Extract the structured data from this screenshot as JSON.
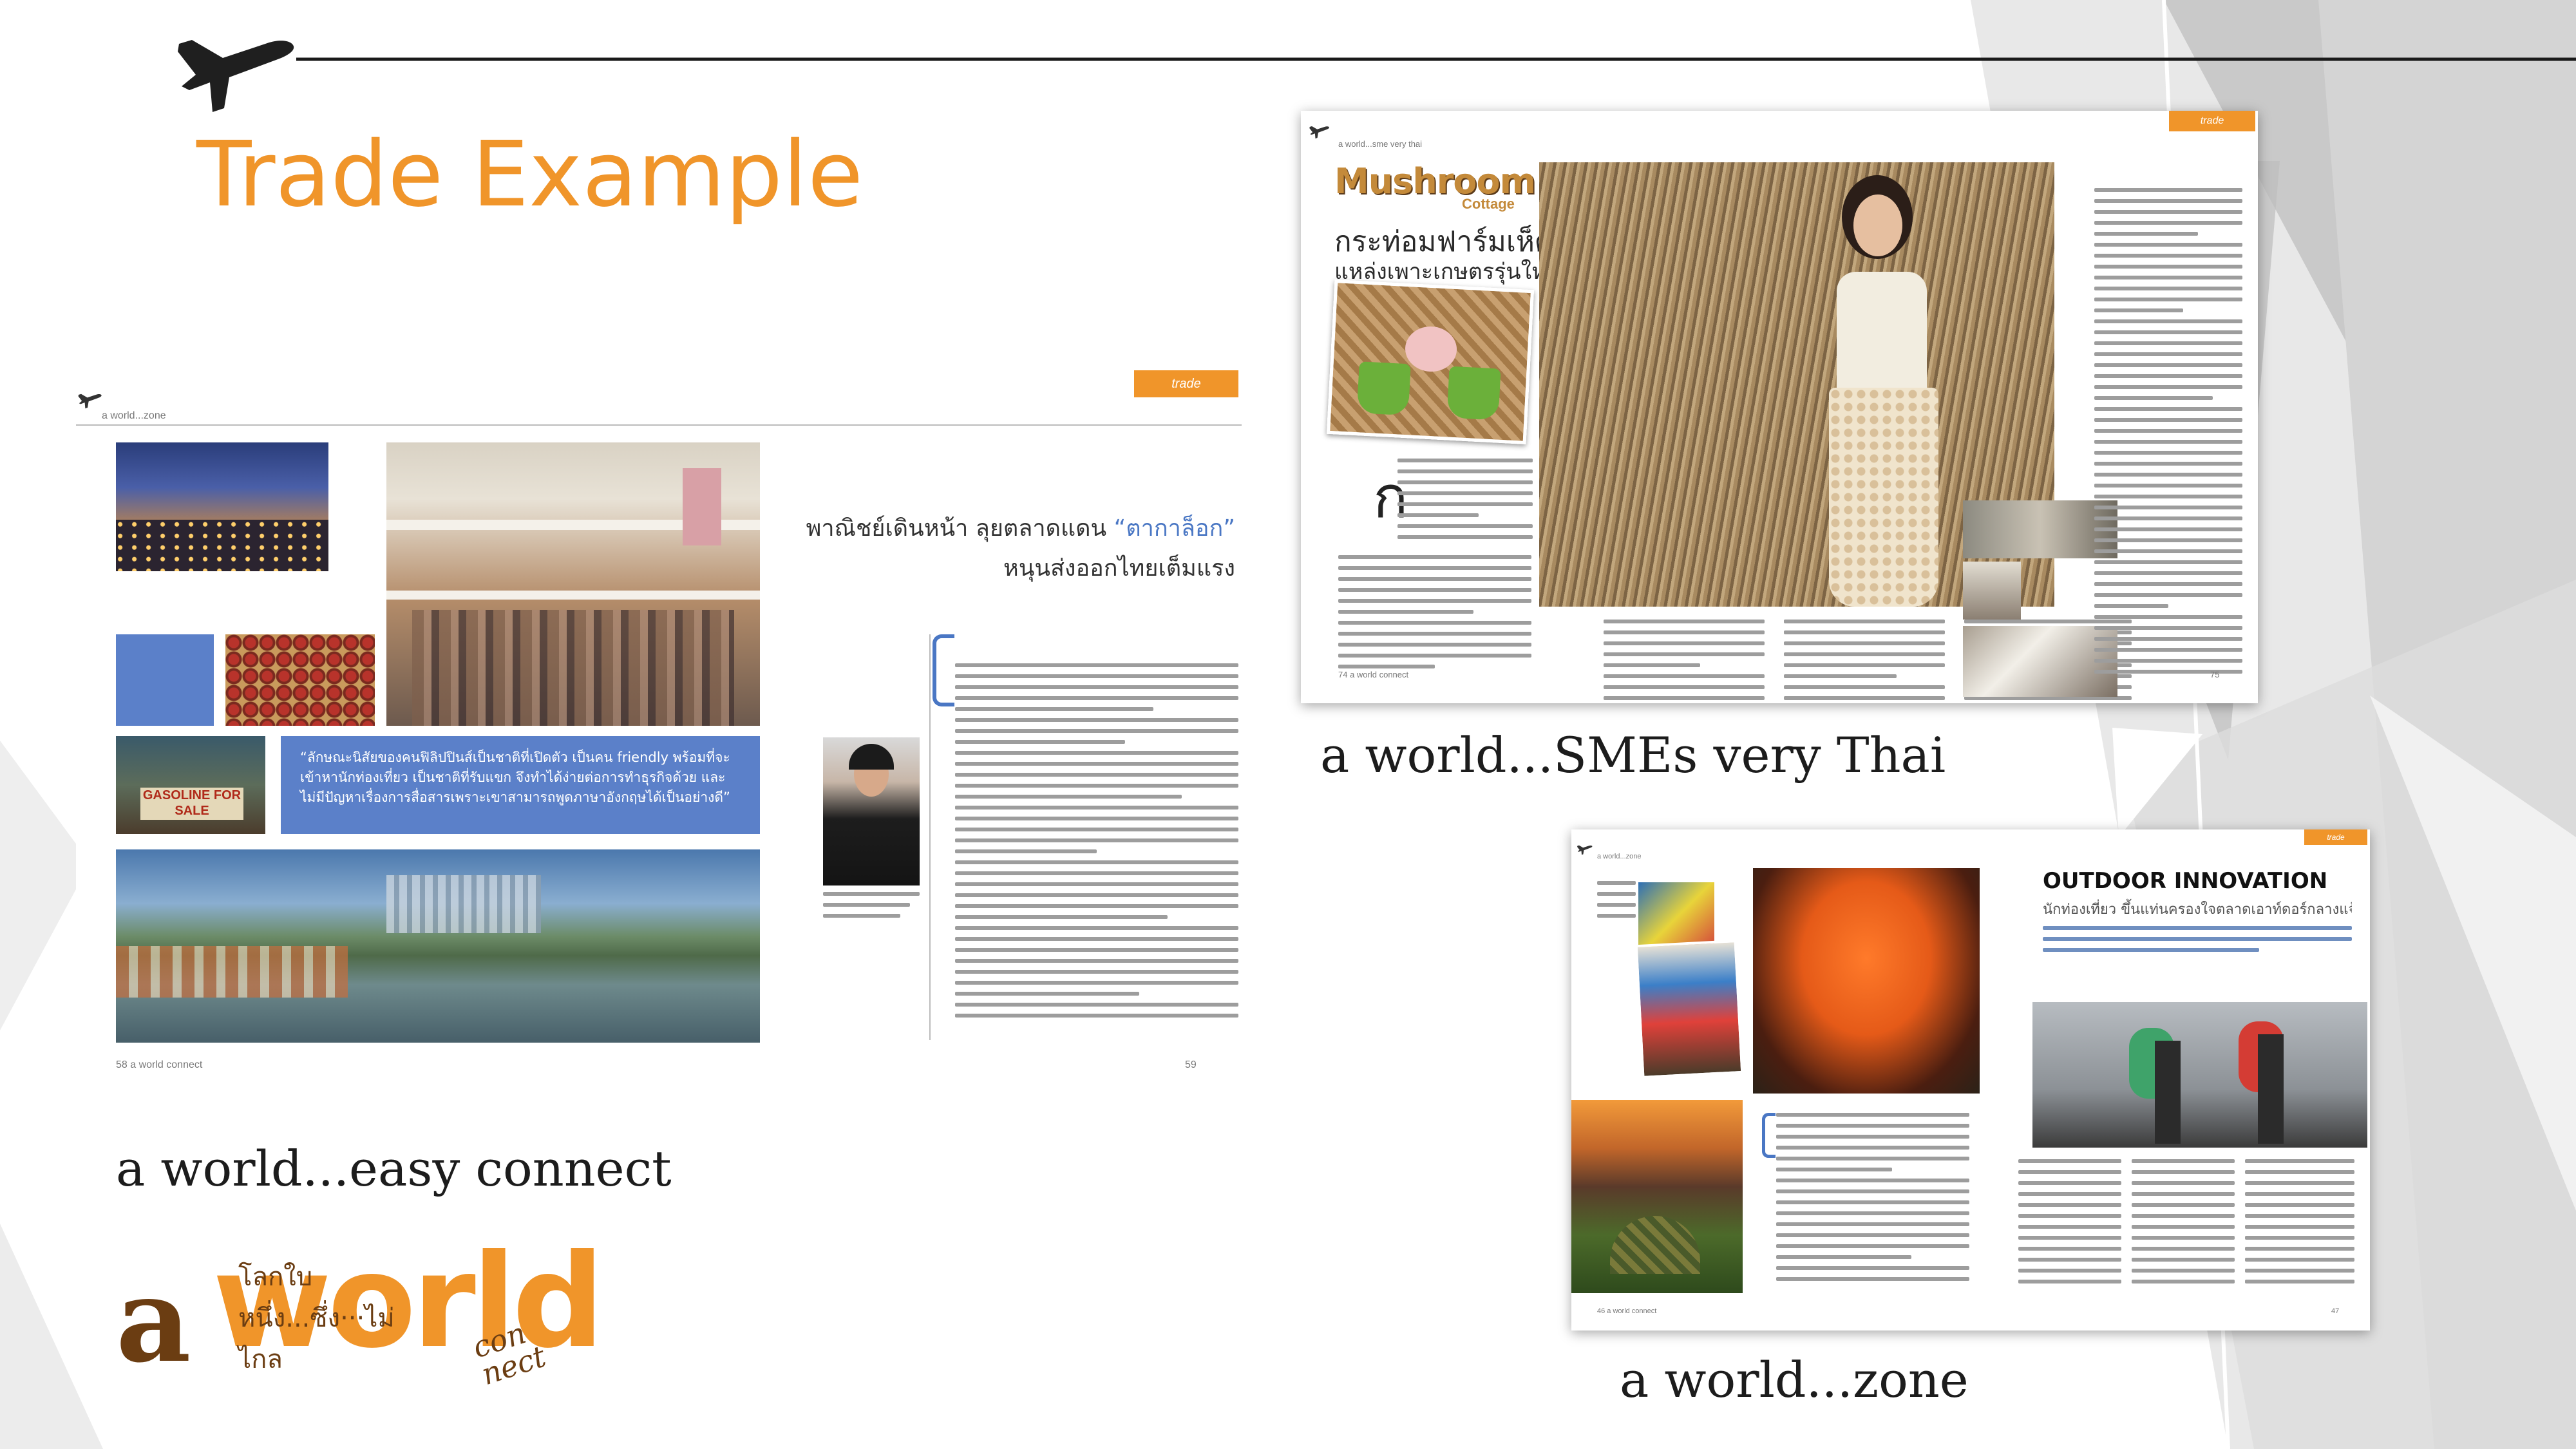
{
  "slide": {
    "title": "Trade Example",
    "captions": {
      "easy_connect": "a world...easy connect",
      "smes": "a world...SMEs very Thai",
      "zone": "a world...zone"
    },
    "logo": {
      "a": "a",
      "world": "world",
      "thai_tagline": "โลกใบหนึ่ง...ซึ่ง···ไม่ไกล",
      "connect_line1": "con",
      "connect_line2": "nect"
    },
    "accent_color": "#f0952a",
    "icon": "airplane-icon"
  },
  "spread_easy_connect": {
    "header": "a world...zone",
    "tag": "trade",
    "headline_line1": "พาณิชย์เดินหน้า ลุยตลาดแดน",
    "headline_highlight": "“ตากาล็อก”",
    "headline_line2": "หนุนส่งออกไทยเต็มแรง",
    "quote": "“ลักษณะนิสัยของคนฟิลิปปินส์เป็นชาติที่เปิดตัว เป็นคน friendly พร้อมที่จะเข้าหานักท่องเที่ยว เป็นชาติที่รับแขก จึงทำได้ง่ายต่อการทำธุรกิจด้วย และไม่มีปัญหาเรื่องการสื่อสารเพราะเขาสามารถพูดภาษาอังกฤษได้เป็นอย่างดี”",
    "sign_text": "GASOLINE FOR SALE",
    "page_left": "58   a world connect",
    "page_right": "59"
  },
  "spread_smes": {
    "header": "a world...sme very thai",
    "tag": "trade",
    "title": "Mushroom",
    "subtitle": "Cottage",
    "thai_headline_1": "กระท่อมฟาร์มเห็ด",
    "thai_headline_2": "แหล่งเพาะเกษตรรุ่นใหม่",
    "page_left": "74   a world connect",
    "page_right": "75"
  },
  "spread_zone": {
    "header": "a world...zone",
    "tag": "trade",
    "title": "OUTDOOR INNOVATION",
    "subtitle": "นักท่องเที่ยว ขึ้นแท่นครองใจตลาดเอาท์ดอร์กลางแจ้ง",
    "page_left": "46   a world connect",
    "page_right": "47"
  }
}
